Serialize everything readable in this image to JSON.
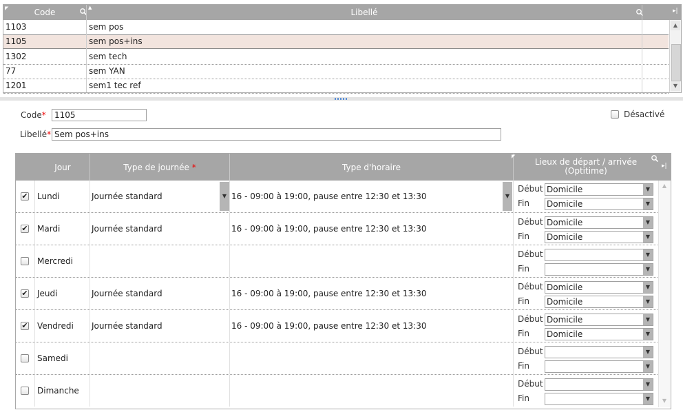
{
  "list": {
    "headers": {
      "code": "Code",
      "libelle": "Libellé"
    },
    "rows": [
      {
        "code": "1103",
        "libelle": "sem pos",
        "selected": false
      },
      {
        "code": "1105",
        "libelle": "sem pos+ins",
        "selected": true
      },
      {
        "code": "1302",
        "libelle": "sem tech",
        "selected": false
      },
      {
        "code": "77",
        "libelle": "sem YAN",
        "selected": false
      },
      {
        "code": "1201",
        "libelle": "sem1 tec ref",
        "selected": false
      }
    ]
  },
  "form": {
    "code_label": "Code",
    "code_value": "1105",
    "libelle_label": "Libellé",
    "libelle_value": "Sem pos+ins",
    "required_mark": "*",
    "desactive_label": "Désactivé",
    "desactive_checked": false
  },
  "days": {
    "headers": {
      "jour": "Jour",
      "type_journee": "Type de journée",
      "type_horaire": "Type d'horaire",
      "lieux_line1": "Lieux de départ / arrivée",
      "lieux_line2": "(Optitime)"
    },
    "debut_label": "Début",
    "fin_label": "Fin",
    "rows": [
      {
        "day": "Lundi",
        "checked": true,
        "type_journee": "Journée standard",
        "type_horaire": "16 - 09:00 à 19:00, pause entre 12:30 et 13:30",
        "debut": "Domicile",
        "fin": "Domicile",
        "editing": true
      },
      {
        "day": "Mardi",
        "checked": true,
        "type_journee": "Journée standard",
        "type_horaire": "16 - 09:00 à 19:00, pause entre 12:30 et 13:30",
        "debut": "Domicile",
        "fin": "Domicile",
        "editing": false
      },
      {
        "day": "Mercredi",
        "checked": false,
        "type_journee": "",
        "type_horaire": "",
        "debut": "",
        "fin": "",
        "editing": false
      },
      {
        "day": "Jeudi",
        "checked": true,
        "type_journee": "Journée standard",
        "type_horaire": "16 - 09:00 à 19:00, pause entre 12:30 et 13:30",
        "debut": "Domicile",
        "fin": "Domicile",
        "editing": false
      },
      {
        "day": "Vendredi",
        "checked": true,
        "type_journee": "Journée standard",
        "type_horaire": "16 - 09:00 à 19:00, pause entre 12:30 et 13:30",
        "debut": "Domicile",
        "fin": "Domicile",
        "editing": false
      },
      {
        "day": "Samedi",
        "checked": false,
        "type_journee": "",
        "type_horaire": "",
        "debut": "",
        "fin": "",
        "editing": false
      },
      {
        "day": "Dimanche",
        "checked": false,
        "type_journee": "",
        "type_horaire": "",
        "debut": "",
        "fin": "",
        "editing": false
      }
    ]
  },
  "icons": {
    "search": "search-icon",
    "sort": "sort-icon",
    "column_menu": "column-menu-icon",
    "dropdown": "chevron-down-icon",
    "check": "check-icon"
  },
  "colors": {
    "header_bg": "#a6a6a6",
    "selected_row": "#f2e4de",
    "required": "#e00000",
    "grip": "#5b8fd6"
  }
}
